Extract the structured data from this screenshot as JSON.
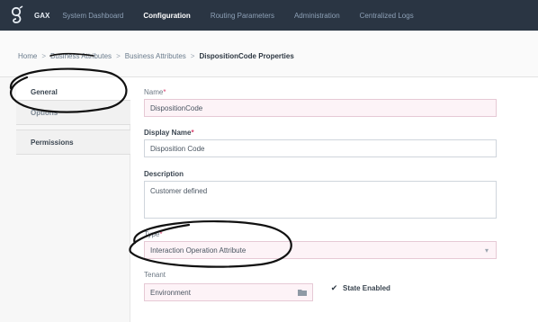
{
  "app": {
    "name": "GAX",
    "logo_icon": "genesys-logo-icon"
  },
  "nav": {
    "tabs": [
      {
        "label": "System Dashboard",
        "active": false
      },
      {
        "label": "Configuration",
        "active": true
      },
      {
        "label": "Routing Parameters",
        "active": false
      },
      {
        "label": "Administration",
        "active": false
      },
      {
        "label": "Centralized Logs",
        "active": false
      }
    ]
  },
  "breadcrumb": {
    "items": [
      "Home",
      "Business Attributes",
      "Business Attributes"
    ],
    "separator": ">",
    "current": "DispositionCode Properties"
  },
  "left_panel": {
    "items": [
      {
        "label": "General",
        "active": true
      },
      {
        "label": "Options",
        "active": false
      },
      {
        "label": "Permissions",
        "active": false
      }
    ]
  },
  "form": {
    "name": {
      "label": "Name",
      "required_mark": "*",
      "value": "DispositionCode"
    },
    "display_name": {
      "label": "Display Name",
      "required_mark": "*",
      "value": "Disposition Code"
    },
    "description": {
      "label": "Description",
      "value": "Customer defined"
    },
    "type": {
      "label": "Type",
      "required_mark": "*",
      "value": "Interaction Operation Attribute",
      "chevron_icon": "chevron-down-icon"
    },
    "tenant": {
      "label": "Tenant",
      "value": "Environment",
      "icon": "folder-icon"
    },
    "state_enabled": {
      "label": "State Enabled",
      "checked": true,
      "check_glyph": "✔"
    }
  },
  "colors": {
    "topbar": "#2a3543",
    "required": "#d8426f",
    "annotation": "#111111"
  }
}
